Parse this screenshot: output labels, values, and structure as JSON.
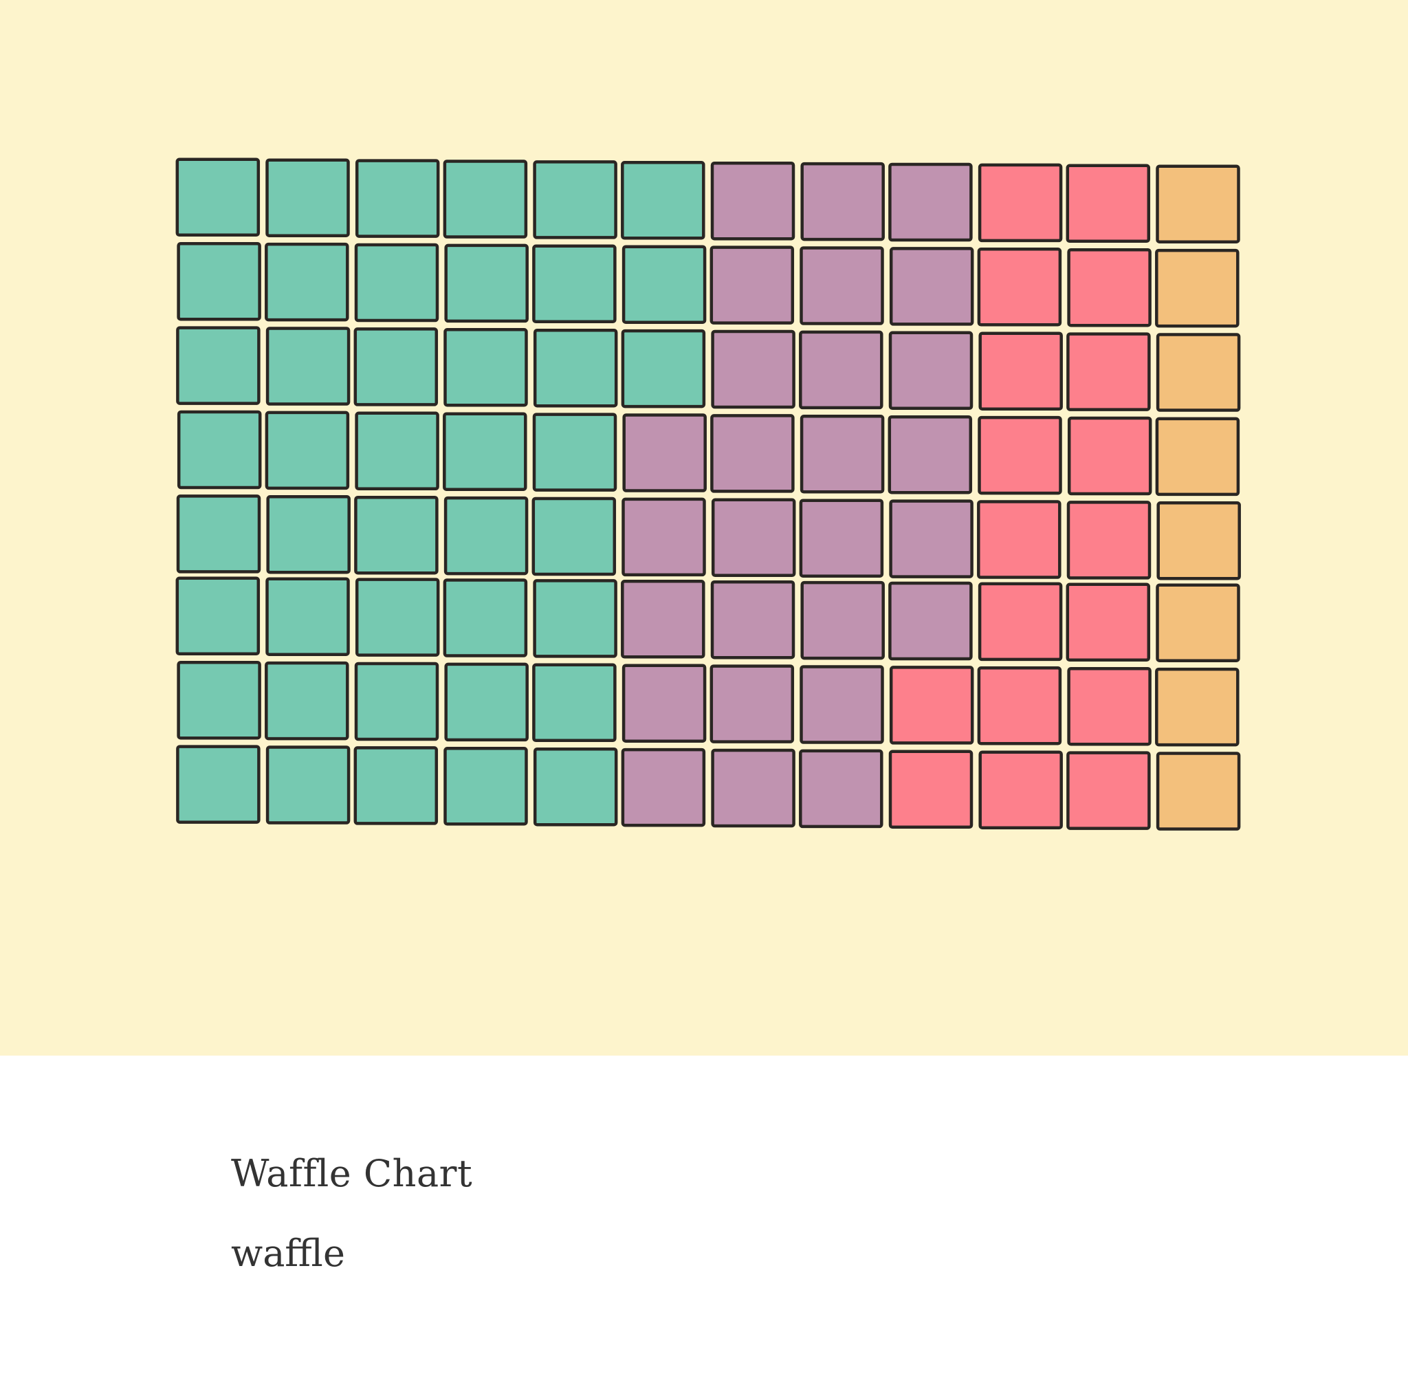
{
  "caption": {
    "title": "Waffle Chart",
    "subtitle": "waffle"
  },
  "colors": {
    "figure_background": "#fdf4cc",
    "cell_stroke": "#2a2623"
  },
  "chart_data": {
    "type": "waffle",
    "rows": 8,
    "columns": 12,
    "fill_order": "column-major, left to right, top to bottom",
    "series": [
      {
        "value": 43,
        "color": "#76c9b1"
      },
      {
        "value": 27,
        "color": "#c093b0"
      },
      {
        "value": 18,
        "color": "#fd808c"
      },
      {
        "value": 8,
        "color": "#f3c07c"
      }
    ],
    "grid": false,
    "legend": "none"
  }
}
